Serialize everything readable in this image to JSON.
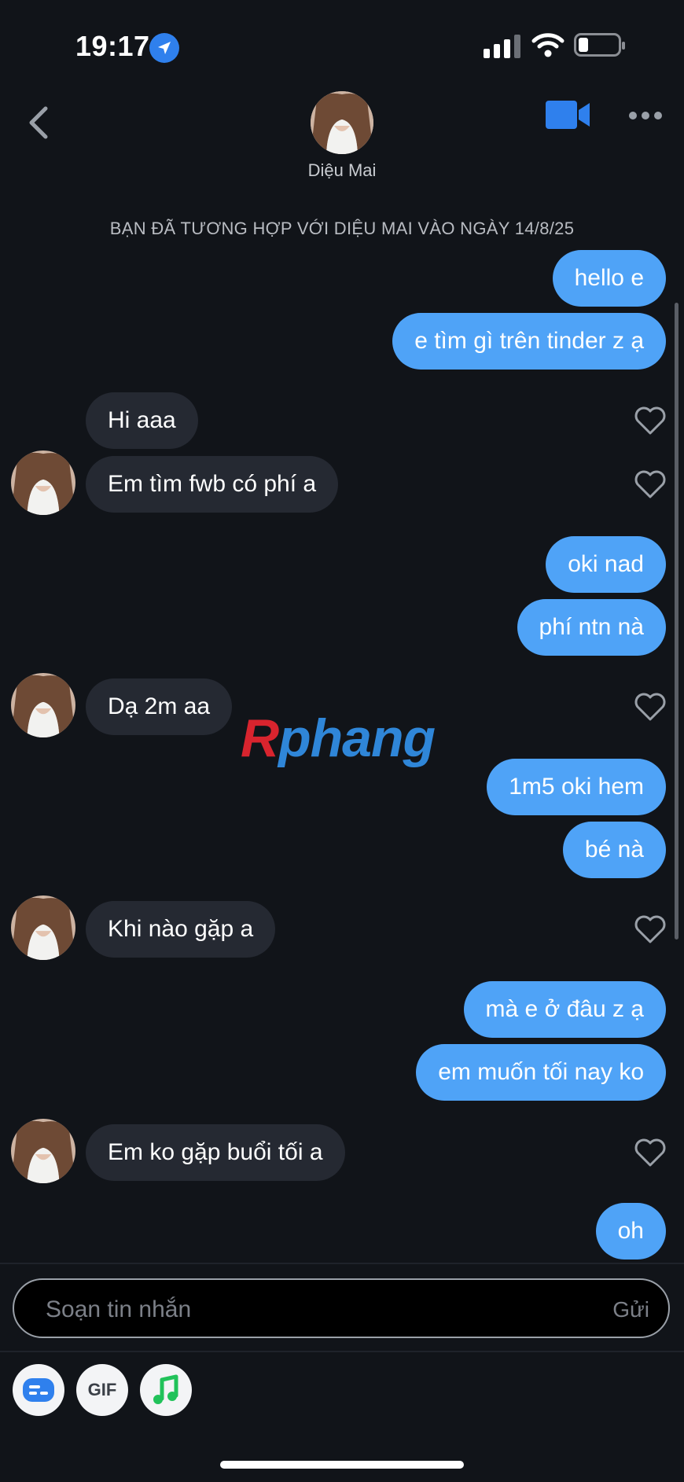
{
  "status_bar": {
    "time": "19:17"
  },
  "header": {
    "contact_name": "Diệu Mai"
  },
  "match_note": "BẠN ĐÃ TƯƠNG HỢP VỚI DIỆU MAI VÀO NGÀY 14/8/25",
  "messages": [
    {
      "side": "sent",
      "text": "hello e"
    },
    {
      "side": "sent",
      "text": "e tìm gì trên tinder z ạ"
    },
    {
      "side": "received",
      "text": "Hi aaa"
    },
    {
      "side": "received",
      "text": "Em tìm fwb có phí a"
    },
    {
      "side": "sent",
      "text": "oki nad"
    },
    {
      "side": "sent",
      "text": "phí ntn nà"
    },
    {
      "side": "received",
      "text": "Dạ 2m aa"
    },
    {
      "side": "sent",
      "text": "1m5 oki hem"
    },
    {
      "side": "sent",
      "text": "bé nà"
    },
    {
      "side": "received",
      "text": "Khi nào gặp a"
    },
    {
      "side": "sent",
      "text": "mà e ở đâu z ạ"
    },
    {
      "side": "sent",
      "text": "em muốn tối nay ko"
    },
    {
      "side": "received",
      "text": "Em ko gặp buổi tối a"
    },
    {
      "side": "sent",
      "text": "oh"
    }
  ],
  "watermark": {
    "part1": "R",
    "part2": "phang"
  },
  "composer": {
    "placeholder": "Soạn tin nhắn",
    "send_label": "Gửi"
  },
  "tools": {
    "gif_label": "GIF"
  },
  "colors": {
    "background": "#111419",
    "sent_bubble": "#4fa3f7",
    "received_bubble": "#252932",
    "accent": "#2f80ed"
  }
}
